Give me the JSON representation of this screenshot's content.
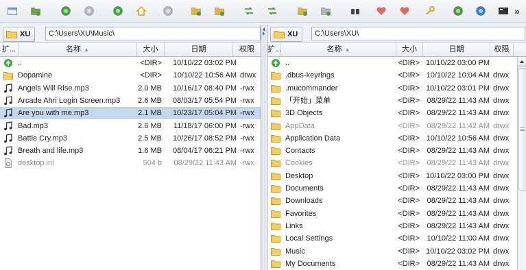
{
  "toolbar": {
    "buttons": [
      {
        "name": "new-window-icon",
        "color": "#6c8ebf"
      },
      {
        "name": "add-tab-icon",
        "color": "#76a34d"
      },
      {
        "name": "back-icon",
        "color": "#3fa83a"
      },
      {
        "name": "forward-icon",
        "color": "#b0b6bd"
      },
      {
        "name": "go-parent-icon",
        "color": "#3fa83a"
      },
      {
        "name": "home-icon",
        "color": "#d9a033"
      },
      {
        "name": "stop-icon",
        "color": "#b0b6bd"
      },
      {
        "name": "new-folder-icon",
        "color": "#e0b640"
      },
      {
        "name": "edit-file-icon",
        "color": "#e0b640"
      },
      {
        "name": "refresh-icon",
        "color": "#4f9a3a"
      },
      {
        "name": "swap-panels-icon",
        "color": "#4f9a3a"
      },
      {
        "name": "mark-files-icon",
        "color": "#e0b640"
      },
      {
        "name": "unmark-files-icon",
        "color": "#b0b6bd"
      },
      {
        "name": "binoculars-icon",
        "color": "#444444"
      },
      {
        "name": "add-bookmark-icon",
        "color": "#e06a6a"
      },
      {
        "name": "bookmarks-icon",
        "color": "#e06a6a"
      },
      {
        "name": "key-icon",
        "color": "#d9a033"
      },
      {
        "name": "network-icon",
        "color": "#4f9a3a"
      },
      {
        "name": "globe-icon",
        "color": "#3a7fc1"
      },
      {
        "name": "terminal-icon",
        "color": "#333333"
      }
    ],
    "more_label": "»"
  },
  "left": {
    "drive": "XU",
    "path": "C:\\Users\\XU\\Music\\",
    "columns": {
      "ext": "扩...",
      "name": "名称",
      "size": "大小",
      "date": "日期",
      "perm": "权限"
    },
    "files": [
      {
        "type": "up",
        "name": "..",
        "size": "<DIR>",
        "date": "10/10/22 03:02 PM",
        "perm": ""
      },
      {
        "type": "folder",
        "name": "Dopamine",
        "size": "<DIR>",
        "date": "10/10/22 10:56 AM",
        "perm": "drwx"
      },
      {
        "type": "audio",
        "name": "Angels Will Rise.mp3",
        "size": "2.0 MB",
        "date": "10/16/17 08:40 PM",
        "perm": "-rwx"
      },
      {
        "type": "audio",
        "name": "Arcade Ahri Login Screen.mp3",
        "size": "2.6 MB",
        "date": "08/03/17 05:54 PM",
        "perm": "-rwx"
      },
      {
        "type": "audio",
        "name": "Are you with me.mp3",
        "size": "2.1 MB",
        "date": "10/23/17 05:04 PM",
        "perm": "-rwx",
        "selected": true
      },
      {
        "type": "audio",
        "name": "Bad.mp3",
        "size": "2.6 MB",
        "date": "11/18/17 06:00 PM",
        "perm": "-rwx"
      },
      {
        "type": "audio",
        "name": "Battle Cry.mp3",
        "size": "2.5 MB",
        "date": "10/26/17 08:52 PM",
        "perm": "-rwx"
      },
      {
        "type": "audio",
        "name": "Breath and life.mp3",
        "size": "1.6 MB",
        "date": "08/04/17 06:21 PM",
        "perm": "-rwx"
      },
      {
        "type": "ini",
        "name": "desktop.ini",
        "size": "504 b",
        "date": "08/29/22 11:43 AM",
        "perm": "-rwx",
        "hidden": true
      }
    ]
  },
  "right": {
    "drive": "XU",
    "path": "C:\\Users\\XU\\",
    "columns": {
      "ext": "扩...",
      "name": "名称",
      "size": "大小",
      "date": "日期",
      "perm": "权限"
    },
    "files": [
      {
        "type": "up",
        "name": "..",
        "size": "<DIR>",
        "date": "10/10/22 03:00 PM",
        "perm": ""
      },
      {
        "type": "folder",
        "name": ".dbus-keyrings",
        "size": "<DIR>",
        "date": "10/10/22 10:04 AM",
        "perm": "drwx"
      },
      {
        "type": "folder",
        "name": ".mucommander",
        "size": "<DIR>",
        "date": "10/10/22 03:01 PM",
        "perm": "drwx"
      },
      {
        "type": "folder",
        "name": "「开始」菜单",
        "size": "<DIR>",
        "date": "08/29/22 11:43 AM",
        "perm": "drwx"
      },
      {
        "type": "folder",
        "name": "3D Objects",
        "size": "<DIR>",
        "date": "08/29/22 11:43 AM",
        "perm": "drwx"
      },
      {
        "type": "folder",
        "name": "AppData",
        "size": "<DIR>",
        "date": "08/29/22 11:42 AM",
        "perm": "drwx",
        "hidden": true
      },
      {
        "type": "folder",
        "name": "Application Data",
        "size": "<DIR>",
        "date": "10/10/22 10:56 AM",
        "perm": "drwx"
      },
      {
        "type": "folder",
        "name": "Contacts",
        "size": "<DIR>",
        "date": "08/29/22 11:43 AM",
        "perm": "drwx"
      },
      {
        "type": "folder",
        "name": "Cookies",
        "size": "<DIR>",
        "date": "08/29/22 11:43 AM",
        "perm": "drwx",
        "hidden": true
      },
      {
        "type": "folder",
        "name": "Desktop",
        "size": "<DIR>",
        "date": "10/10/22 03:00 PM",
        "perm": "drwx"
      },
      {
        "type": "folder",
        "name": "Documents",
        "size": "<DIR>",
        "date": "08/29/22 11:43 AM",
        "perm": "drwx"
      },
      {
        "type": "folder",
        "name": "Downloads",
        "size": "<DIR>",
        "date": "08/29/22 11:43 AM",
        "perm": "drwx"
      },
      {
        "type": "folder",
        "name": "Favorites",
        "size": "<DIR>",
        "date": "08/29/22 11:43 AM",
        "perm": "drwx"
      },
      {
        "type": "folder",
        "name": "Links",
        "size": "<DIR>",
        "date": "08/29/22 11:43 AM",
        "perm": "drwx"
      },
      {
        "type": "folder",
        "name": "Local Settings",
        "size": "<DIR>",
        "date": "10/10/22 11:00 AM",
        "perm": "drwx"
      },
      {
        "type": "folder",
        "name": "Music",
        "size": "<DIR>",
        "date": "10/10/22 03:02 PM",
        "perm": "drwx"
      },
      {
        "type": "folder",
        "name": "My Documents",
        "size": "<DIR>",
        "date": "08/29/22 11:43 AM",
        "perm": "drwx"
      }
    ]
  }
}
